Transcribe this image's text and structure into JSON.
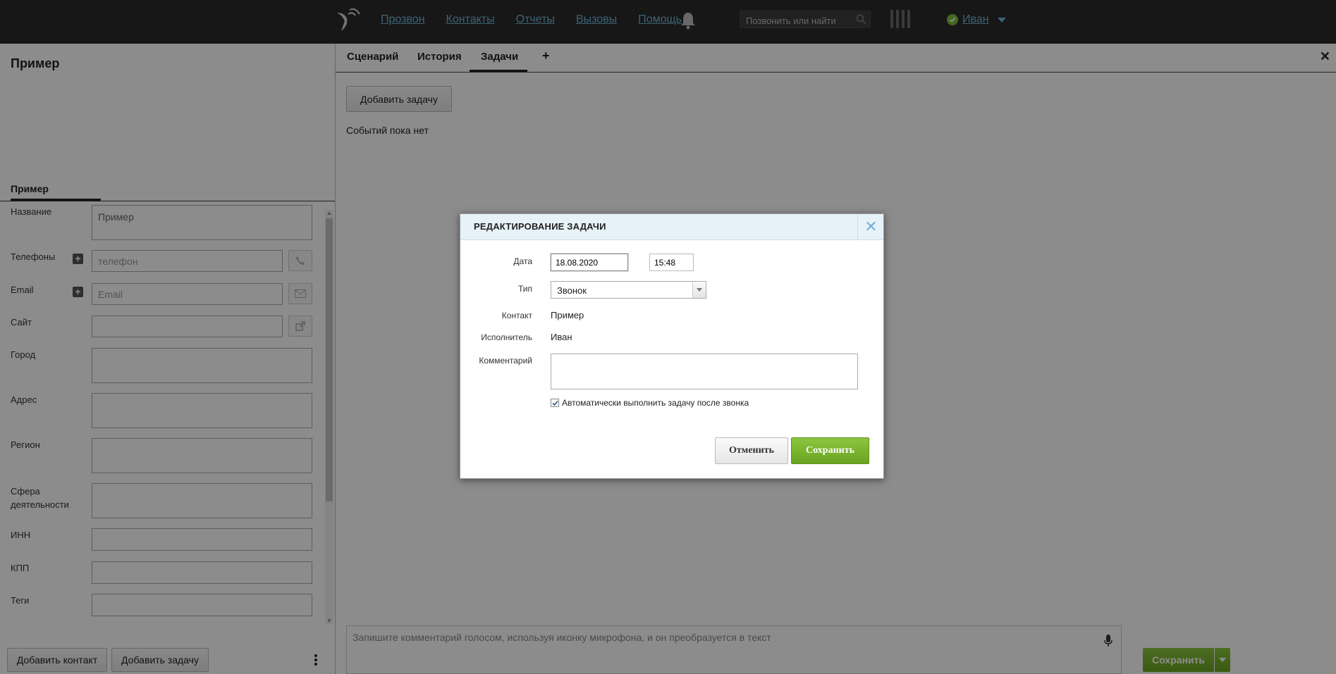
{
  "colors": {
    "accent": "#6fb4d6",
    "green": "#7cbd3a",
    "topbar": "#2b2b2b"
  },
  "topbar": {
    "nav": [
      "Прозвон",
      "Контакты",
      "Отчеты",
      "Вызовы",
      "Помощь"
    ],
    "search_placeholder": "Позвонить или найти",
    "user_name": "Иван",
    "icons": [
      "logo-icon",
      "bell-icon",
      "search-icon",
      "dialpad-icon",
      "status-check-icon",
      "chevron-down-icon"
    ]
  },
  "left": {
    "title": "Пример",
    "tab": "Пример",
    "fields": {
      "name_label": "Название",
      "name_value": "Пример",
      "phones_label": "Телефоны",
      "phone_placeholder": "телефон",
      "email_label": "Email",
      "email_placeholder": "Email",
      "site_label": "Сайт",
      "city_label": "Город",
      "address_label": "Адрес",
      "region_label": "Регион",
      "sphere_label": "Сфера деятельности",
      "inn_label": "ИНН",
      "kpp_label": "КПП",
      "tags_label": "Теги"
    },
    "bottom": {
      "add_contact": "Добавить контакт",
      "add_task": "Добавить задачу"
    }
  },
  "right": {
    "tabs": [
      "Сценарий",
      "История",
      "Задачи",
      "+"
    ],
    "active_tab": "Задачи",
    "close": "✕",
    "add_task_btn": "Добавить задачу",
    "no_events": "Событий пока нет",
    "comment_placeholder": "Запишите комментарий голосом, используя иконку микрофона, и он преобразуется в текст",
    "save": "Сохранить"
  },
  "modal": {
    "title": "РЕДАКТИРОВАНИЕ ЗАДАЧИ",
    "date_label": "Дата",
    "date_value": "18.08.2020",
    "time_value": "15:48",
    "type_label": "Тип",
    "type_value": "Звонок",
    "contact_label": "Контакт",
    "contact_value": "Пример",
    "executor_label": "Исполнитель",
    "executor_value": "Иван",
    "comment_label": "Комментарий",
    "auto_label": "Автоматически выполнить задачу после звонка",
    "auto_checked": true,
    "cancel": "Отменить",
    "save": "Сохранить"
  }
}
